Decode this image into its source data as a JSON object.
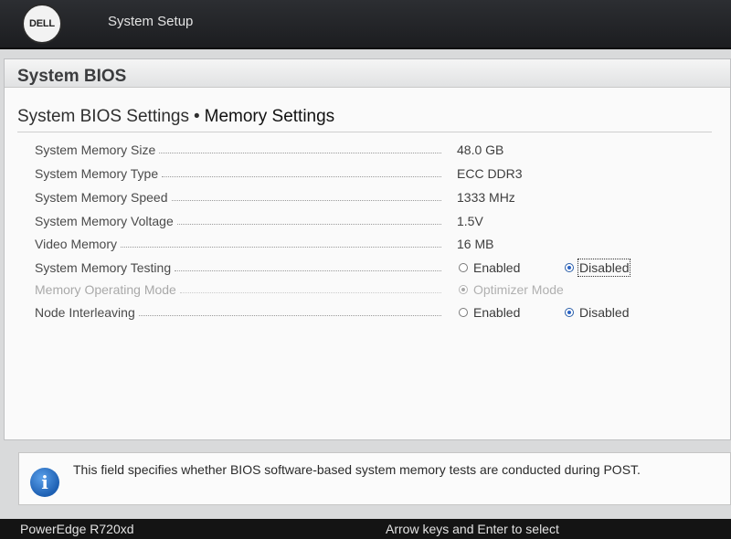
{
  "header": {
    "logo_text": "DELL",
    "app_title": "System Setup"
  },
  "panel": {
    "title": "System BIOS",
    "breadcrumb": {
      "parent": "System BIOS Settings",
      "separator": "•",
      "current": "Memory Settings"
    }
  },
  "settings": [
    {
      "label": "System Memory Size",
      "value": "48.0 GB"
    },
    {
      "label": "System Memory Type",
      "value": "ECC DDR3"
    },
    {
      "label": "System Memory Speed",
      "value": "1333 MHz"
    },
    {
      "label": "System Memory Voltage",
      "value": "1.5V"
    },
    {
      "label": "Video Memory",
      "value": "16 MB"
    },
    {
      "label": "System Memory Testing",
      "options": [
        "Enabled",
        "Disabled"
      ],
      "selected": "Disabled"
    },
    {
      "label": "Memory Operating Mode",
      "options": [
        "Optimizer Mode"
      ],
      "selected": "Optimizer Mode",
      "disabled": true
    },
    {
      "label": "Node Interleaving",
      "options": [
        "Enabled",
        "Disabled"
      ],
      "selected": "Disabled"
    }
  ],
  "help": {
    "icon": "info-icon",
    "icon_glyph": "i",
    "text": "This field specifies whether BIOS software-based system memory tests are conducted during POST."
  },
  "footer": {
    "model": "PowerEdge R720xd",
    "hint": "Arrow keys and Enter to select"
  },
  "colors": {
    "accent": "#2b63c4",
    "topbar": "#1c1d20",
    "footer": "#141414"
  }
}
